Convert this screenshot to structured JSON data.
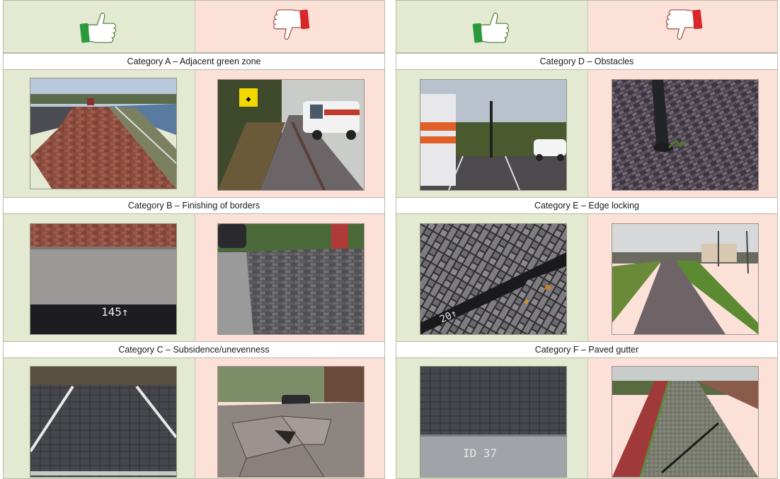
{
  "colors": {
    "good_bg": "#e4ead1",
    "bad_bg": "#fbe1d8",
    "thumb_up": "#2a9a3c",
    "thumb_down": "#d8262a"
  },
  "headers": {
    "good_icon": "thumbs-up-icon",
    "bad_icon": "thumbs-down-icon"
  },
  "categories": [
    {
      "title": "Category A – Adjacent green zone"
    },
    {
      "title": "Category B – Finishing of borders"
    },
    {
      "title": "Category C – Subsidence/unevenness"
    },
    {
      "title": "Category D – Obstacles"
    },
    {
      "title": "Category E – Edge locking"
    },
    {
      "title": "Category F – Paved gutter"
    }
  ],
  "chalk_marks": {
    "b_good": "145↑",
    "e_good": "20↑",
    "f_good": "ID 37"
  },
  "sign_text": "◆"
}
